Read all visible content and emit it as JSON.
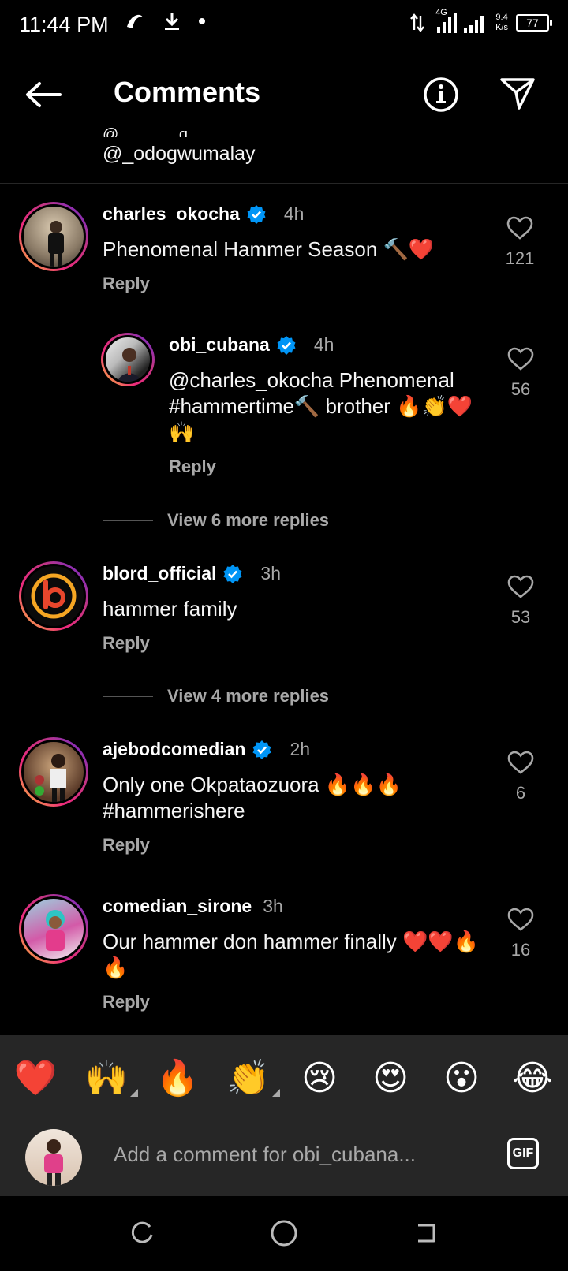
{
  "status_bar": {
    "time": "11:44 PM",
    "network": "4G",
    "speed_value": "9.4",
    "speed_unit": "K/s",
    "battery": "77"
  },
  "header": {
    "title": "Comments"
  },
  "previous": {
    "mention": "@_odogwumalay"
  },
  "comments": [
    {
      "username": "charles_okocha",
      "verified": true,
      "time": "4h",
      "text": "Phenomenal Hammer Season 🔨❤️",
      "reply": "Reply",
      "likes": "121"
    },
    {
      "username": "obi_cubana",
      "verified": true,
      "time": "4h",
      "text": "@charles_okocha Phenomenal #hammertime🔨 brother 🔥👏❤️🙌",
      "reply": "Reply",
      "likes": "56"
    },
    {
      "username": "blord_official",
      "verified": true,
      "time": "3h",
      "text": "hammer family",
      "reply": "Reply",
      "likes": "53"
    },
    {
      "username": "ajebodcomedian",
      "verified": true,
      "time": "2h",
      "text": "Only one Okpataozuora 🔥🔥🔥 #hammerishere",
      "reply": "Reply",
      "likes": "6"
    },
    {
      "username": "comedian_sirone",
      "verified": false,
      "time": "3h",
      "text": "Our hammer don hammer finally ❤️❤️🔥🔥",
      "reply": "Reply",
      "likes": "16"
    }
  ],
  "view_more": [
    "View 6 more replies",
    "View 4 more replies"
  ],
  "reactions": [
    "❤️",
    "🙌",
    "🔥",
    "👏",
    "😢",
    "😍",
    "😮",
    "😂"
  ],
  "composer": {
    "placeholder": "Add a comment for obi_cubana...",
    "gif_label": "GIF"
  },
  "colors": {
    "background": "#000000",
    "bar": "#262626",
    "verified": "#0095f6",
    "secondary_text": "#a8a8a8"
  }
}
